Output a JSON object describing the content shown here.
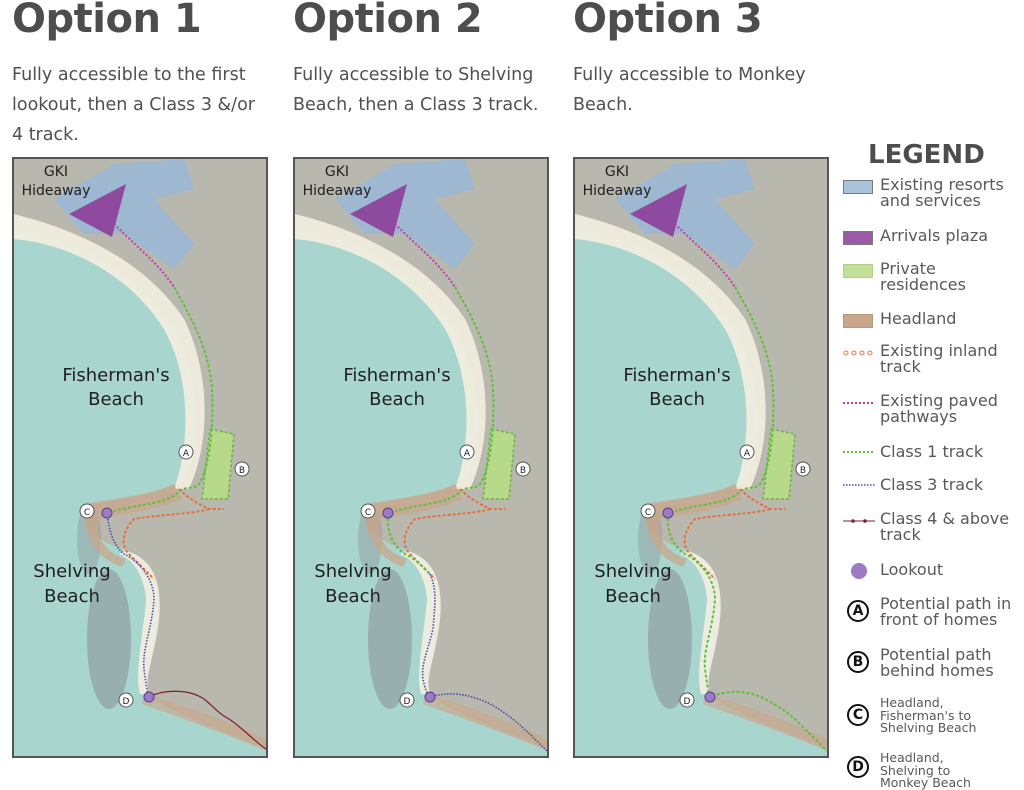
{
  "options": [
    {
      "title": "Option 1",
      "description": "Fully accessible to the first lookout, then a Class 3 &/or 4 track."
    },
    {
      "title": "Option 2",
      "description": "Fully accessible to Shelving Beach, then a Class 3 track."
    },
    {
      "title": "Option 3",
      "description": "Fully accessible to Monkey Beach."
    }
  ],
  "map_labels": {
    "resort": "GKI",
    "resort2": "Hideaway",
    "fishermans1": "Fisherman's",
    "fishermans2": "Beach",
    "shelving1": "Shelving",
    "shelving2": "Beach",
    "marker_a": "A",
    "marker_b": "B",
    "marker_c": "C",
    "marker_d": "D"
  },
  "legend": {
    "title": "LEGEND",
    "items": [
      {
        "label": "Existing resorts and services",
        "icon": "blue-area-swatch",
        "color": "#a9c3dc"
      },
      {
        "label": "Arrivals plaza",
        "icon": "purple-area-swatch",
        "color": "#9a5aa6"
      },
      {
        "label": "Private residences",
        "icon": "green-area-swatch",
        "color": "#c2e09a"
      },
      {
        "label": "Headland",
        "icon": "tan-area-swatch",
        "color": "#c9a78a"
      },
      {
        "label": "Existing inland track",
        "icon": "orange-dotted-line",
        "color": "#e07a4a"
      },
      {
        "label": "Existing paved pathways",
        "icon": "magenta-dotted-line",
        "color": "#b63ca8"
      },
      {
        "label": "Class 1 track",
        "icon": "green-dotted-line",
        "color": "#5fbf3a"
      },
      {
        "label": "Class 3 track",
        "icon": "navy-dotted-line",
        "color": "#4b4aa0"
      },
      {
        "label": "Class 4 & above track",
        "icon": "maroon-dot-line",
        "color": "#7a1f2a"
      },
      {
        "label": "Lookout",
        "icon": "purple-circle",
        "color": "#9b7cc4"
      },
      {
        "label": "Potential path in front of homes",
        "icon": "circle-letter",
        "letter": "A"
      },
      {
        "label": "Potential path behind homes",
        "icon": "circle-letter",
        "letter": "B"
      },
      {
        "label": "Headland, Fisherman's to Shelving Beach",
        "icon": "circle-letter",
        "letter": "C"
      },
      {
        "label": "Headland, Shelving to Monkey Beach",
        "icon": "circle-letter",
        "letter": "D"
      }
    ]
  }
}
